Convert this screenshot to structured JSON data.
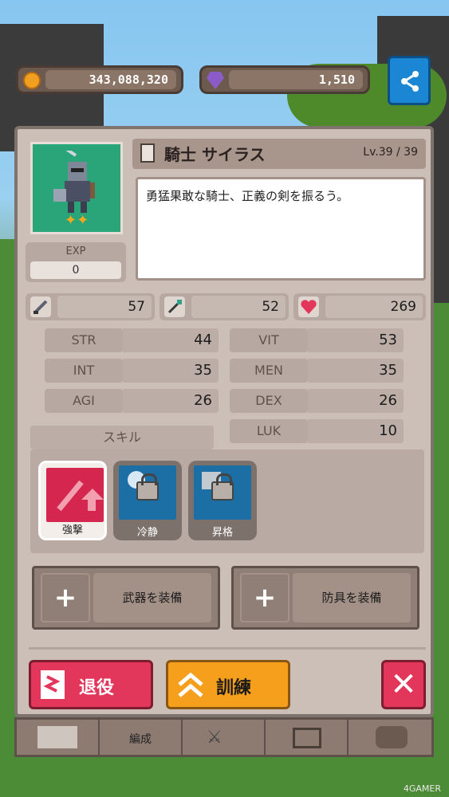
{
  "currency": {
    "gold": "343,088,320",
    "gems": "1,510"
  },
  "character": {
    "name": "騎士 サイラス",
    "level": "Lv.39 / 39",
    "description": "勇猛果敢な騎士、正義の剣を振るう。",
    "exp_label": "EXP",
    "exp_value": "0"
  },
  "primary_stats": {
    "attack": "57",
    "magic": "52",
    "hp": "269"
  },
  "attributes": {
    "str_label": "STR",
    "str": "44",
    "vit_label": "VIT",
    "vit": "53",
    "int_label": "INT",
    "int": "35",
    "men_label": "MEN",
    "men": "35",
    "agi_label": "AGI",
    "agi": "26",
    "dex_label": "DEX",
    "dex": "26",
    "luk_label": "LUK",
    "luk": "10"
  },
  "skills": {
    "title": "スキル",
    "items": [
      {
        "label": "強撃"
      },
      {
        "label": "冷静"
      },
      {
        "label": "昇格"
      }
    ]
  },
  "equipment": {
    "weapon_label": "武器を装備",
    "armor_label": "防具を装備"
  },
  "actions": {
    "retire": "退役",
    "train": "訓練"
  },
  "nav": {
    "formation": "編成"
  },
  "watermark": "4GAMER",
  "colors": {
    "accent_red": "#e2365b",
    "accent_orange": "#f69f1c",
    "share_blue": "#1a86d4"
  }
}
